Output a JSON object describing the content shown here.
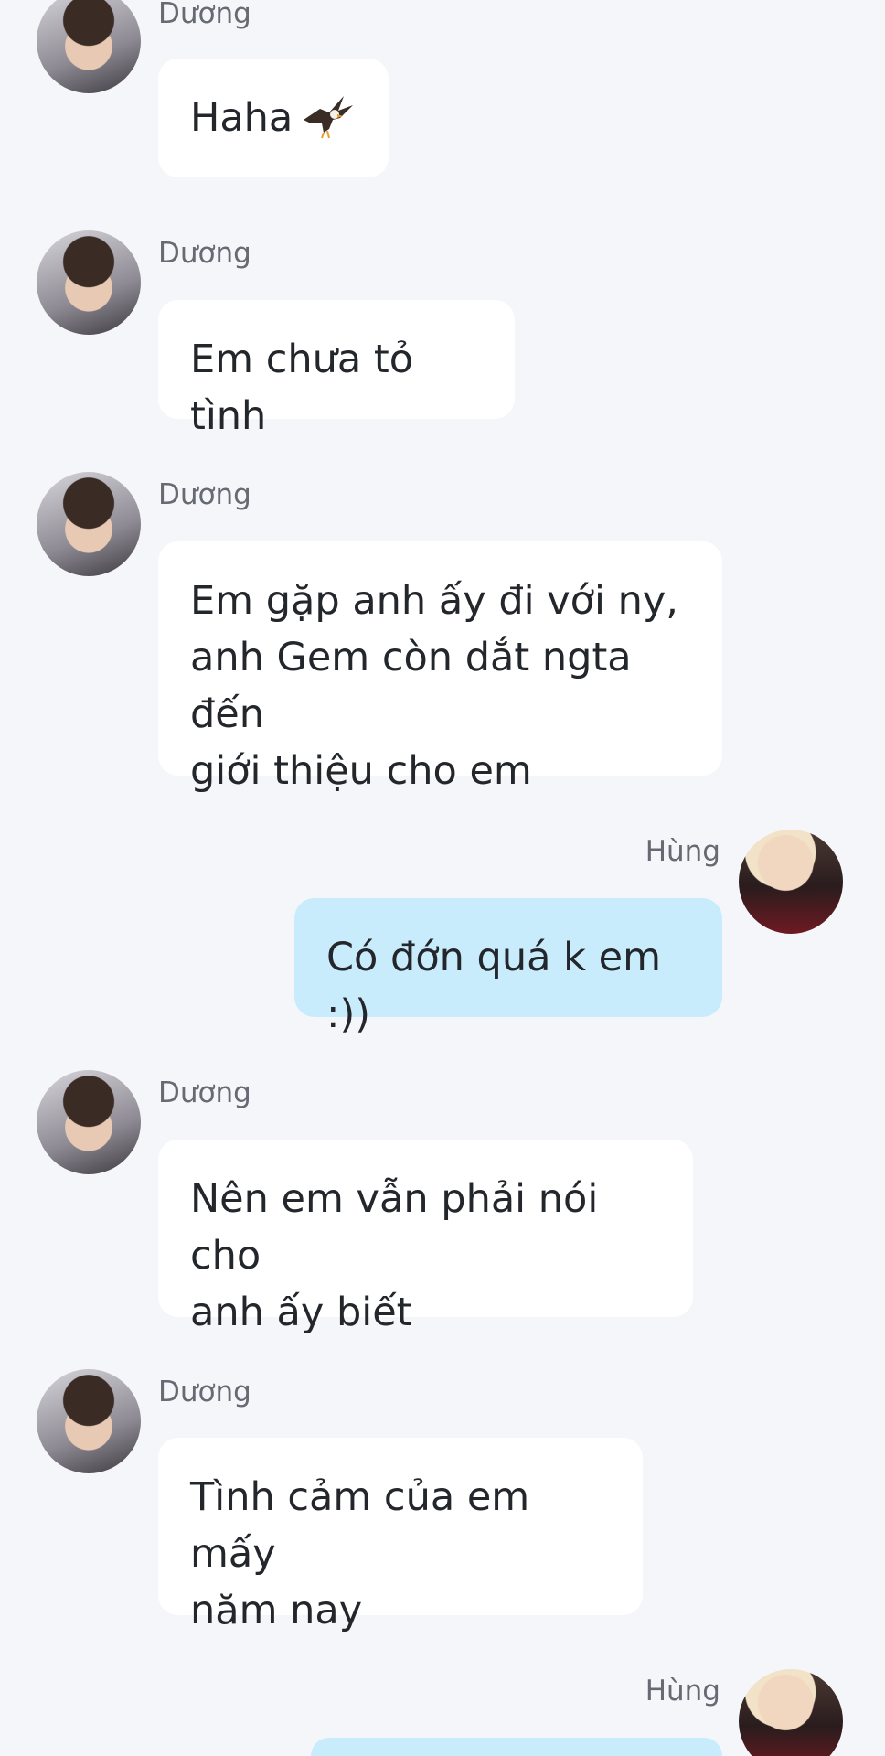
{
  "messages": [
    {
      "sender": "Dương",
      "lines": [
        "Haha"
      ],
      "emoji": "eagle-emoji"
    },
    {
      "sender": "Dương",
      "lines": [
        "Em chưa tỏ tình"
      ]
    },
    {
      "sender": "Dương",
      "lines": [
        "Em gặp anh ấy đi với ny,",
        "anh Gem còn dắt ngta đến",
        "giới thiệu cho em"
      ]
    },
    {
      "sender": "Hùng",
      "lines": [
        "Có đớn quá k em :))"
      ]
    },
    {
      "sender": "Dương",
      "lines": [
        "Nên em vẫn phải nói cho",
        "anh ấy biết"
      ]
    },
    {
      "sender": "Dương",
      "lines": [
        "Tình cảm của em mấy",
        "năm nay"
      ]
    },
    {
      "sender": "Hùng",
      "lines": [
        ""
      ]
    }
  ],
  "colors": {
    "background": "#f5f6f9",
    "incoming_bubble": "#ffffff",
    "outgoing_bubble": "#c9ecfc"
  }
}
